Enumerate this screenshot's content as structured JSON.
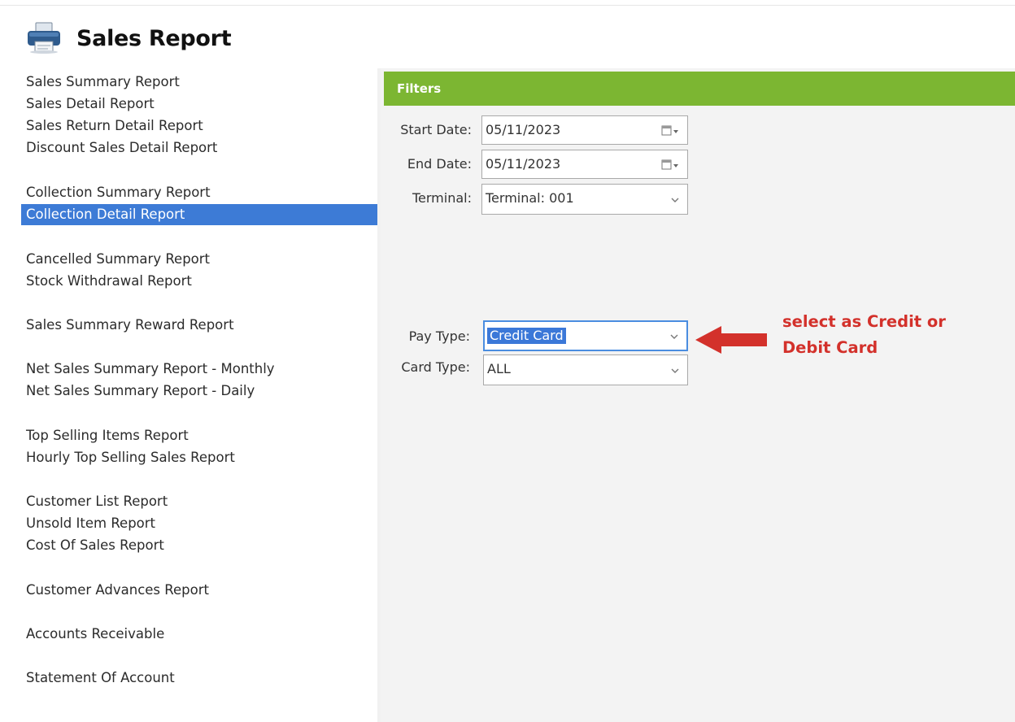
{
  "app": {
    "title": "Sales Report",
    "icon": "printer-icon"
  },
  "sidebar": {
    "selected_index": 5,
    "items": [
      {
        "label": "Sales Summary Report"
      },
      {
        "label": "Sales Detail Report"
      },
      {
        "label": "Sales Return Detail Report"
      },
      {
        "label": "Discount Sales Detail Report"
      },
      {
        "label": "Collection Summary Report"
      },
      {
        "label": "Collection Detail Report"
      },
      {
        "label": "Cancelled Summary Report"
      },
      {
        "label": "Stock Withdrawal Report"
      },
      {
        "label": "Sales Summary Reward Report"
      },
      {
        "label": "Net Sales Summary Report - Monthly"
      },
      {
        "label": "Net Sales Summary Report - Daily"
      },
      {
        "label": "Top Selling Items Report"
      },
      {
        "label": "Hourly Top Selling Sales Report"
      },
      {
        "label": "Customer List Report"
      },
      {
        "label": "Unsold Item Report"
      },
      {
        "label": "Cost Of Sales Report"
      },
      {
        "label": "Customer Advances Report"
      },
      {
        "label": "Accounts Receivable"
      },
      {
        "label": "Statement Of Account"
      }
    ]
  },
  "filters": {
    "heading": "Filters",
    "start_date": {
      "label": "Start Date:",
      "value": "05/11/2023",
      "icon": "calendar-icon"
    },
    "end_date": {
      "label": "End Date:",
      "value": "05/11/2023",
      "icon": "calendar-icon"
    },
    "terminal": {
      "label": "Terminal:",
      "value": "Terminal: 001"
    },
    "pay_type": {
      "label": "Pay Type:",
      "value": "Credit Card"
    },
    "card_type": {
      "label": "Card Type:",
      "value": "ALL"
    }
  },
  "annotation": {
    "line1": "select as Credit or",
    "line2": "Debit Card",
    "color": "#d3312b"
  },
  "colors": {
    "accent": "#7cb632",
    "selection": "#3d7bd6"
  }
}
